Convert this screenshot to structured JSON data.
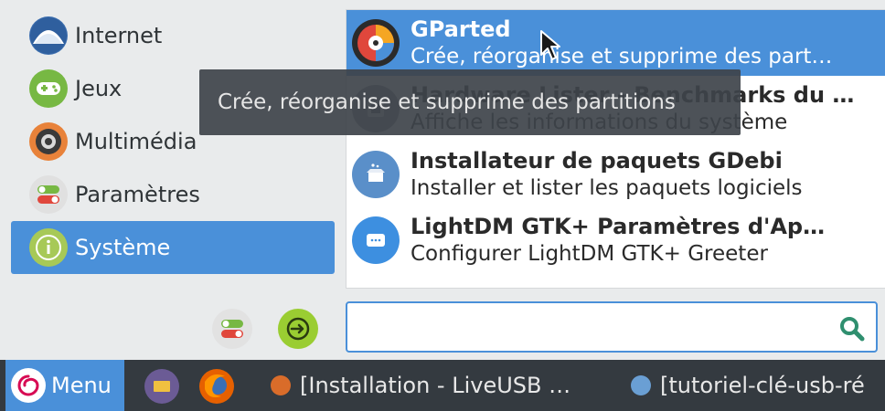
{
  "categories": [
    {
      "label": "Internet",
      "icon": "internet-icon",
      "active": false
    },
    {
      "label": "Jeux",
      "icon": "games-icon",
      "active": false
    },
    {
      "label": "Multimédia",
      "icon": "multimedia-icon",
      "active": false
    },
    {
      "label": "Paramètres",
      "icon": "settings-icon",
      "active": false
    },
    {
      "label": "Système",
      "icon": "system-icon",
      "active": true
    }
  ],
  "apps": [
    {
      "name": "GParted",
      "description": "Crée, réorganise et supprime des part…",
      "icon": "gparted-icon",
      "selected": true
    },
    {
      "name": "Hardware Lister - Benchmarks du …",
      "description": "Affiche les informations du système",
      "icon": "hardware-icon",
      "selected": false
    },
    {
      "name": "Installateur de paquets GDebi",
      "description": "Installer et lister les paquets logiciels",
      "icon": "gdebi-icon",
      "selected": false
    },
    {
      "name": "LightDM GTK+ Paramètres d'Ap…",
      "description": "Configurer LightDM GTK+ Greeter",
      "icon": "lightdm-icon",
      "selected": false
    }
  ],
  "tooltip": {
    "text": "Crée, réorganise et supprime des partitions"
  },
  "search": {
    "value": "",
    "placeholder": ""
  },
  "taskbar": {
    "menu_label": "Menu",
    "tasks": [
      {
        "label": "[Installation - LiveUSB …",
        "icon": "firefox-task-icon"
      },
      {
        "label": "[tutoriel-clé-usb-ré",
        "icon": "editor-task-icon"
      }
    ]
  },
  "colors": {
    "accent": "#4a90d9",
    "taskbar": "#343a40",
    "tooltip": "#3e434a"
  }
}
